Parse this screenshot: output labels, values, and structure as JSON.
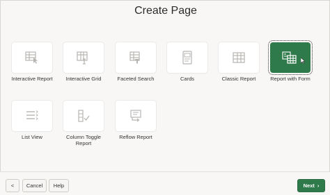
{
  "dialog": {
    "title": "Create Page"
  },
  "tiles": [
    {
      "label": "Interactive Report",
      "icon": "interactive-report-icon"
    },
    {
      "label": "Interactive Grid",
      "icon": "interactive-grid-icon"
    },
    {
      "label": "Faceted Search",
      "icon": "faceted-search-icon"
    },
    {
      "label": "Cards",
      "icon": "cards-icon"
    },
    {
      "label": "Classic Report",
      "icon": "classic-report-icon"
    },
    {
      "label": "Report with Form",
      "icon": "report-with-form-icon",
      "selected": true
    },
    {
      "label": "List View",
      "icon": "list-view-icon"
    },
    {
      "label": "Column Toggle Report",
      "icon": "column-toggle-report-icon"
    },
    {
      "label": "Reflow Report",
      "icon": "reflow-report-icon"
    }
  ],
  "footer": {
    "back_label": "<",
    "cancel_label": "Cancel",
    "help_label": "Help",
    "next_label": "Next"
  },
  "colors": {
    "accent": "#2f7a4a"
  }
}
